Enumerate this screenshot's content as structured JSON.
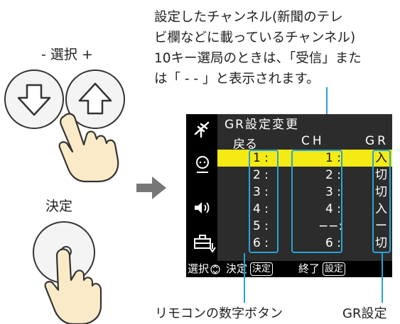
{
  "left": {
    "select_label": "-  選択  +",
    "confirm_label": "決定"
  },
  "description": {
    "line1": "設定したチャンネル(新聞のテレ",
    "line2": "ビ欄などに載っているチャンネル)",
    "line3": "10キー選局のときは、「受信」また",
    "line4": "は「 - - 」と表示されます。"
  },
  "osd": {
    "title": "GR設定変更",
    "back": "戻る",
    "ch_header": "CH",
    "gr_header": "GR",
    "rows": [
      {
        "num": "1 :",
        "ch": "1 :",
        "gr": "入"
      },
      {
        "num": "2 :",
        "ch": "2 :",
        "gr": "切"
      },
      {
        "num": "3 :",
        "ch": "3 :",
        "gr": "切"
      },
      {
        "num": "4 :",
        "ch": "4 :",
        "gr": "入"
      },
      {
        "num": "5 :",
        "ch": "−−:",
        "gr": "ー"
      },
      {
        "num": "6 :",
        "ch": "6 :",
        "gr": "切"
      }
    ],
    "footer": {
      "select": "選択",
      "decide": "決定",
      "decide_key": "決定",
      "end": "終了",
      "end_key": "設定"
    }
  },
  "callouts": {
    "remote_digits": "リモコンの数字ボタン",
    "gr_setting": "GR設定"
  },
  "colors": {
    "highlight_row": "#f4ea14",
    "callout": "#29a3d6",
    "arrow": "#777777"
  }
}
